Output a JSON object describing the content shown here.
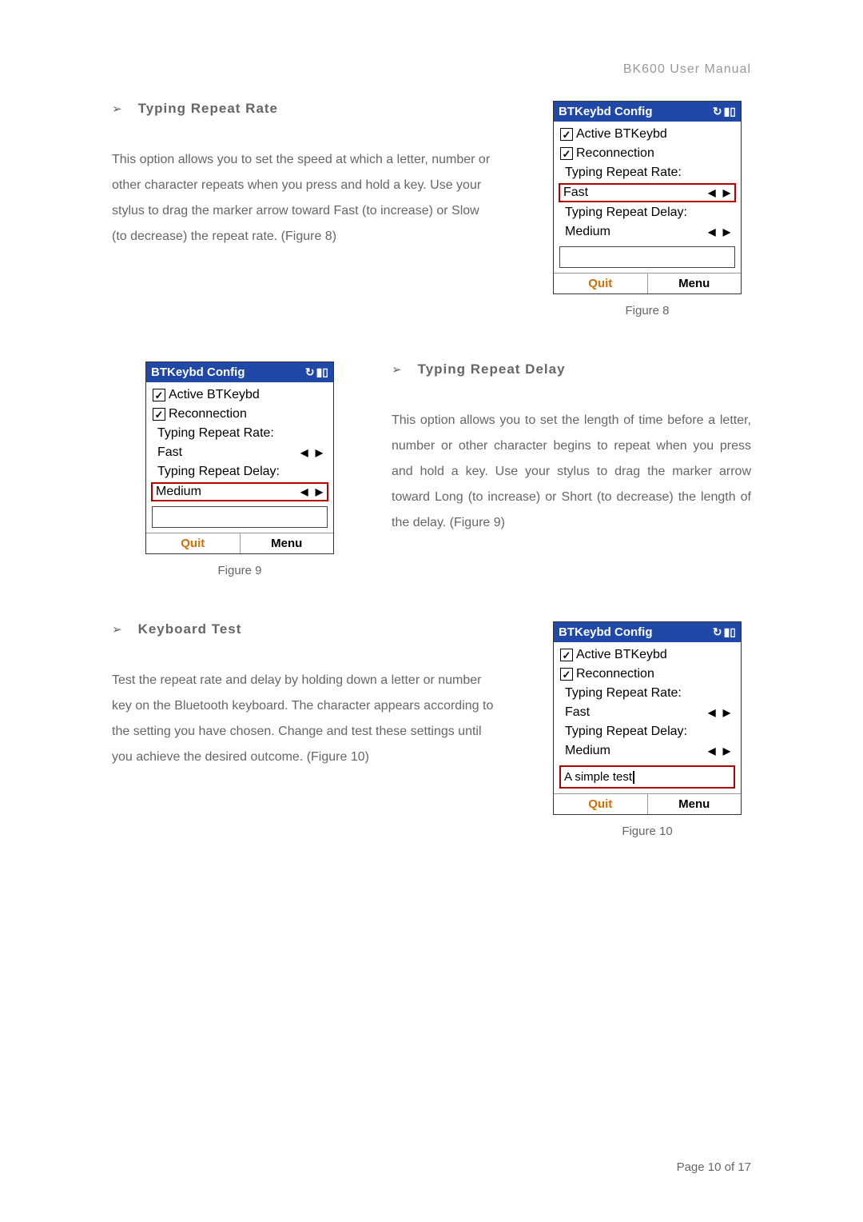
{
  "header": "BK600 User Manual",
  "footer": "Page 10 of 17",
  "sections": {
    "s1": {
      "heading": "Typing Repeat Rate",
      "body": "This option allows you to set the speed at which a letter, number or other character repeats when you press and hold a key. Use your stylus to drag the marker arrow toward Fast (to increase) or Slow (to decrease) the repeat rate. (Figure 8)",
      "caption": "Figure 8"
    },
    "s2": {
      "heading": "Typing Repeat Delay",
      "body": "This option allows you to set the length of time before a letter, number or other character begins to repeat when you press and hold a key. Use your stylus to drag the marker arrow toward Long (to increase) or Short (to decrease) the length of the delay. (Figure 9)",
      "caption": "Figure 9"
    },
    "s3": {
      "heading": "Keyboard Test",
      "body": "Test the repeat rate and delay by holding down a letter or number key on the Bluetooth keyboard. The character appears according to the setting you have chosen. Change and test these settings until you achieve the desired outcome. (Figure 10)",
      "caption": "Figure 10"
    }
  },
  "phone": {
    "title": "BTKeybd Config",
    "active": "Active BTKeybd",
    "reconnection": "Reconnection",
    "rate_label": "Typing Repeat Rate:",
    "rate_value": "Fast",
    "delay_label": "Typing Repeat Delay:",
    "delay_value": "Medium",
    "test_value": "A simple test",
    "quit": "Quit",
    "menu": "Menu"
  }
}
